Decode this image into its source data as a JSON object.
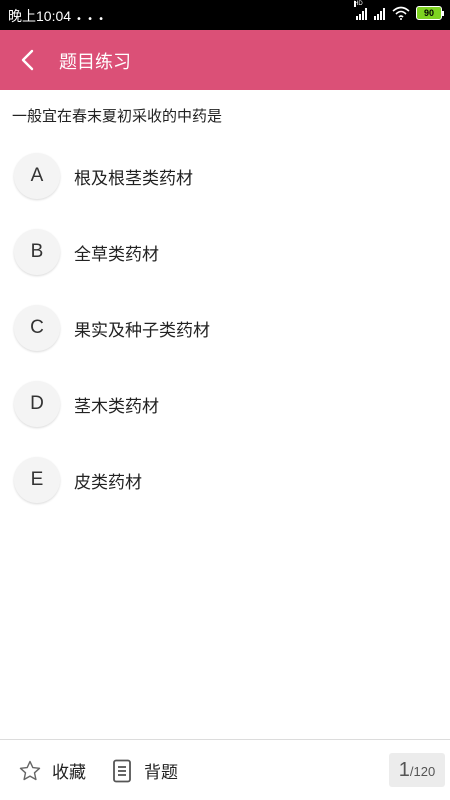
{
  "status_bar": {
    "time": "晚上10:04",
    "signal_label": "HD",
    "battery": "90"
  },
  "header": {
    "title": "题目练习",
    "back_icon": "chevron-left-icon"
  },
  "question": {
    "text": "一般宜在春末夏初采收的中药是",
    "options": [
      {
        "letter": "A",
        "text": "根及根茎类药材"
      },
      {
        "letter": "B",
        "text": "全草类药材"
      },
      {
        "letter": "C",
        "text": "果实及种子类药材"
      },
      {
        "letter": "D",
        "text": "茎木类药材"
      },
      {
        "letter": "E",
        "text": "皮类药材"
      }
    ]
  },
  "bottom_bar": {
    "favorite_label": "收藏",
    "favorite_icon": "star-icon",
    "memorize_label": "背题",
    "memorize_icon": "document-icon",
    "current_page": "1",
    "total_pages": "/120"
  },
  "colors": {
    "header_bg": "#db5077",
    "battery": "#7ed321"
  }
}
